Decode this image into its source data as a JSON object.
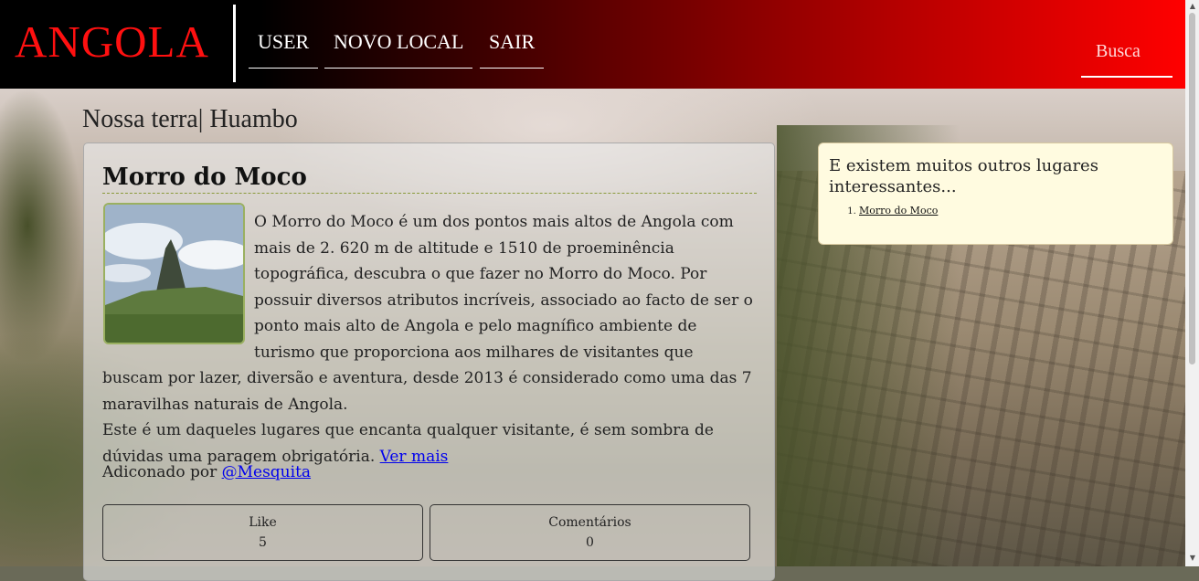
{
  "header": {
    "brand": "ANGOLA",
    "nav": [
      {
        "label": "USER"
      },
      {
        "label": "NOVO LOCAL"
      },
      {
        "label": "SAIR"
      }
    ],
    "search_placeholder": "Busca"
  },
  "page": {
    "heading": "Nossa terra| Huambo"
  },
  "post": {
    "title": "Morro do Moco",
    "body_p1": "O Morro do Moco é um dos pontos mais altos de Angola com mais de 2. 620 m de altitude e 1510 de proeminência topográfica, descubra o que fazer no Morro do Moco. Por possuir diversos atributos incríveis, associado ao facto de ser o ponto mais alto de Angola e pelo magnífico ambiente de turismo que proporciona aos milhares de visitantes que buscam por lazer, diversão e aventura, desde 2013 é considerado como uma das 7 maravilhas naturais de Angola.",
    "body_p2": "Este é um daqueles lugares que encanta qualquer visitante, é sem sombra de dúvidas uma paragem obrigatória.",
    "read_more": "Ver mais",
    "added_by_label": "Adiconado por",
    "author": "@Mesquita",
    "stats": [
      {
        "label": "Like",
        "value": "5"
      },
      {
        "label": "Comentários",
        "value": "0"
      }
    ]
  },
  "aside": {
    "title": "E existem muitos outros lugares interessantes...",
    "places": [
      "Morro do Moco"
    ]
  },
  "colors": {
    "brand": "#ff1010",
    "header_gradient_end": "#ff0000",
    "aside_bg": "#fffbe0",
    "link": "#0000ee"
  }
}
